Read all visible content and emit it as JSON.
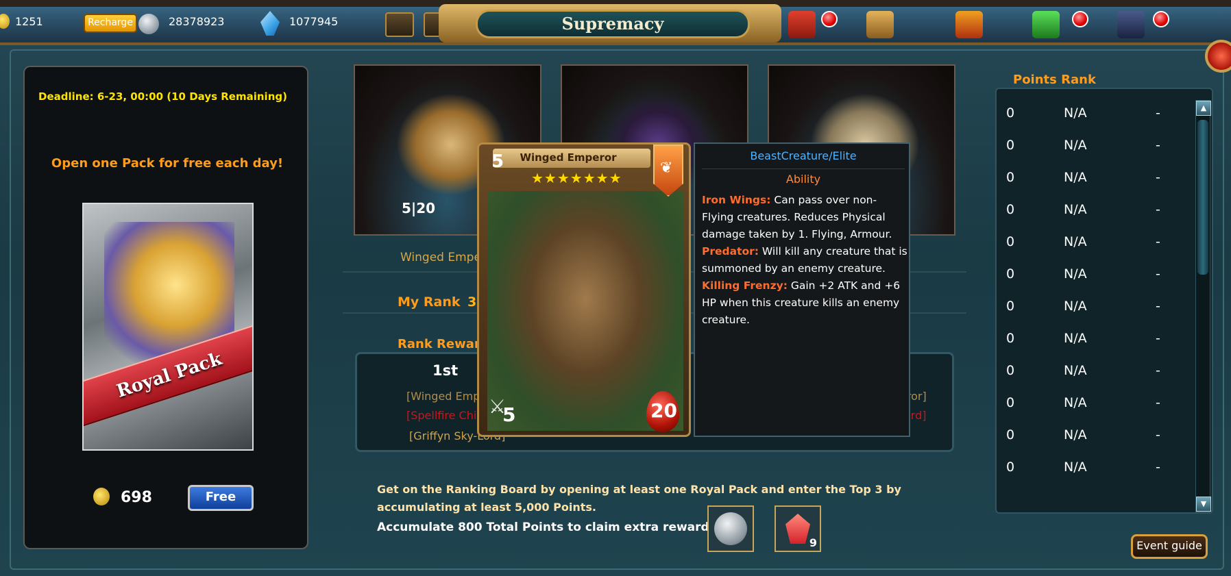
{
  "topbar": {
    "gold": "1251",
    "recharge_label": "Recharge",
    "silver": "28378923",
    "crystals": "1077945"
  },
  "window": {
    "title": "Supremacy"
  },
  "left_panel": {
    "deadline": "Deadline: 6-23, 00:00 (10 Days Remaining)",
    "free_daily": "Open one Pack for free each day!",
    "pack_label": "Royal Pack",
    "price": "698",
    "free_button": "Free"
  },
  "thumbs": [
    {
      "stat": "5|20"
    },
    {
      "stat": ""
    },
    {
      "stat": ""
    }
  ],
  "main": {
    "card_name_label": "Winged Empe",
    "my_rank_label": "My Rank",
    "my_rank_value": "3",
    "rank_reward_label": "Rank Rewar",
    "place": "1st",
    "reward_left_1": "[Winged Emp",
    "reward_left_2": "[Spellfire Chi",
    "reward_left_3": "[Griffyn Sky-Lord]",
    "reward_right_1": "eror]",
    "reward_right_2": "ord]",
    "description": "Get on the Ranking Board by opening at least one Royal Pack and enter the Top 3 by accumulating at least 5,000 Points.",
    "accumulate": "Accumulate 800 Total Points to claim extra rewards:",
    "extra_gem_count": "9",
    "event_guide": "Event guide"
  },
  "points_rank": {
    "title": "Points Rank",
    "rows": [
      {
        "points": "0",
        "name": "N/A",
        "guild": "-"
      },
      {
        "points": "0",
        "name": "N/A",
        "guild": "-"
      },
      {
        "points": "0",
        "name": "N/A",
        "guild": "-"
      },
      {
        "points": "0",
        "name": "N/A",
        "guild": "-"
      },
      {
        "points": "0",
        "name": "N/A",
        "guild": "-"
      },
      {
        "points": "0",
        "name": "N/A",
        "guild": "-"
      },
      {
        "points": "0",
        "name": "N/A",
        "guild": "-"
      },
      {
        "points": "0",
        "name": "N/A",
        "guild": "-"
      },
      {
        "points": "0",
        "name": "N/A",
        "guild": "-"
      },
      {
        "points": "0",
        "name": "N/A",
        "guild": "-"
      },
      {
        "points": "0",
        "name": "N/A",
        "guild": "-"
      },
      {
        "points": "0",
        "name": "N/A",
        "guild": "-"
      }
    ]
  },
  "card_tooltip": {
    "name": "Winged Emperor",
    "cost": "5",
    "stars": "★★★★★★★",
    "atk": "5",
    "hp": "20",
    "type": "BeastCreature/Elite",
    "ability_header": "Ability",
    "abilities": [
      {
        "name": "Iron Wings:",
        "text": " Can pass over non-Flying creatures. Reduces Physical damage taken by 1. Flying, Armour."
      },
      {
        "name": "Predator:",
        "text": " Will kill any creature that is summoned by an enemy creature."
      },
      {
        "name": "Killing Frenzy:",
        "text": " Gain +2 ATK and +6 HP when this creature kills an enemy creature."
      }
    ]
  },
  "colors": {
    "accent_orange": "#ff9c1c",
    "deadline_yellow": "#ffe400",
    "type_blue": "#4fb2ff",
    "keyword_orange": "#ff6c2c"
  }
}
